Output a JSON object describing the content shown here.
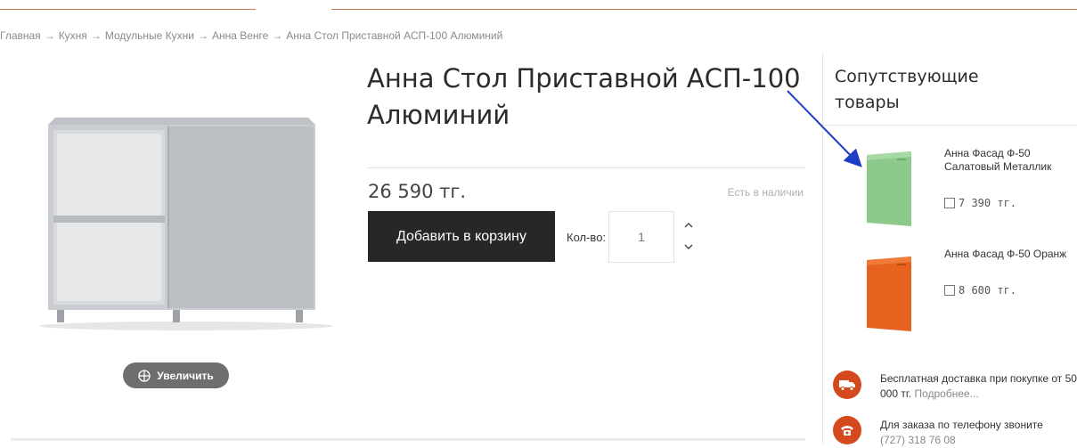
{
  "breadcrumb": {
    "items": [
      "Главная",
      "Кухня",
      "Модульные Кухни",
      "Анна Венге",
      "Анна Стол Приставной АСП-100 Алюминий"
    ],
    "separator": "→"
  },
  "product": {
    "title": "Анна Стол Приставной АСП-100 Алюминий",
    "price": "26 590 тг.",
    "stock": "Есть в наличии",
    "add_to_cart": "Добавить в корзину",
    "qty_label": "Кол-во:",
    "qty_value": "1",
    "zoom_label": "Увеличить"
  },
  "related": {
    "title": "Сопутствующие товары",
    "items": [
      {
        "name": "Анна Фасад Ф-50 Салатовый Металлик",
        "price": "7 390 тг.",
        "color": "#8dc98a"
      },
      {
        "name": "Анна Фасад Ф-50 Оранж",
        "price": "8 600 тг.",
        "color": "#e8621f"
      }
    ]
  },
  "info": {
    "delivery_text": "Бесплатная доставка при покупке от 50 000 тг.",
    "delivery_link": "Подробнее...",
    "phone_text": "Для заказа по телефону звоните",
    "phone_number": "(727) 318 76 08",
    "delivery_icon": "truck-icon",
    "phone_icon": "phone-icon"
  },
  "colors": {
    "accent": "#d44a1e",
    "annotation_arrow": "#1f3cc4",
    "button_dark": "#272727"
  }
}
